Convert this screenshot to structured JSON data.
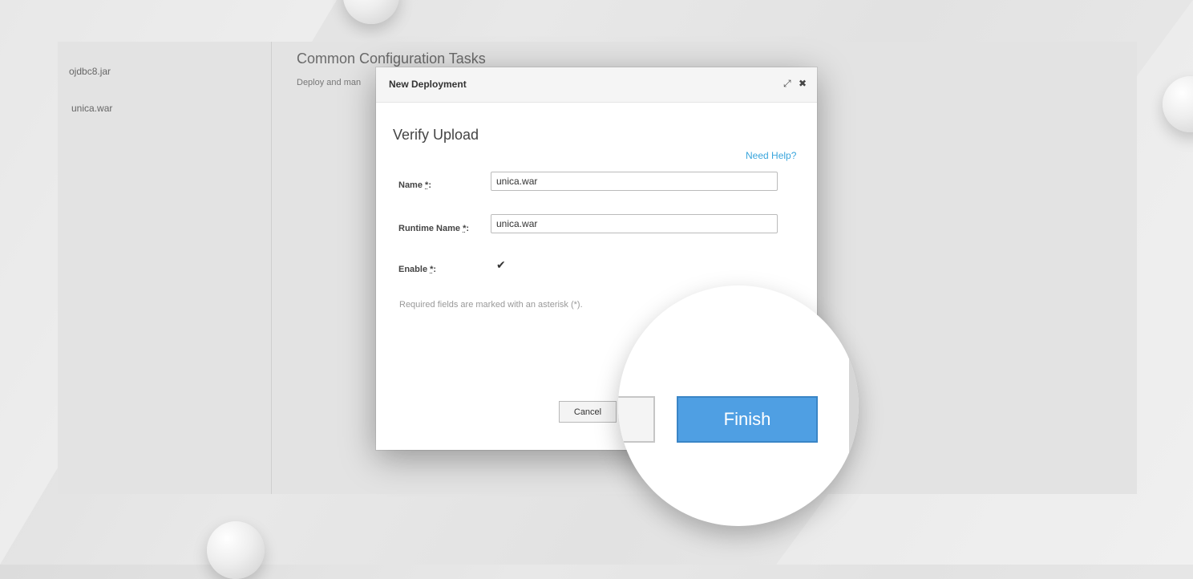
{
  "sidebar": {
    "items": [
      "ojdbc8.jar",
      "unica.war"
    ]
  },
  "main": {
    "title": "Common Configuration Tasks",
    "subtitle": "Deploy and man"
  },
  "modal": {
    "title": "New Deployment",
    "maximize_icon": "⤢",
    "close_icon": "✖",
    "step_title": "Verify Upload",
    "help_link": "Need Help?",
    "fields": {
      "name": {
        "label": "Name",
        "value": "unica.war"
      },
      "runtime_name": {
        "label": "Runtime Name",
        "value": "unica.war"
      },
      "enable": {
        "label": "Enable",
        "checked": true
      }
    },
    "required_mark": "*",
    "required_note": "Required fields are marked with an asterisk (*).",
    "cancel_label": "Cancel",
    "finish_label": "Finish"
  },
  "colors": {
    "accent": "#39a5dc",
    "finish_button": "#4f9fe3"
  }
}
